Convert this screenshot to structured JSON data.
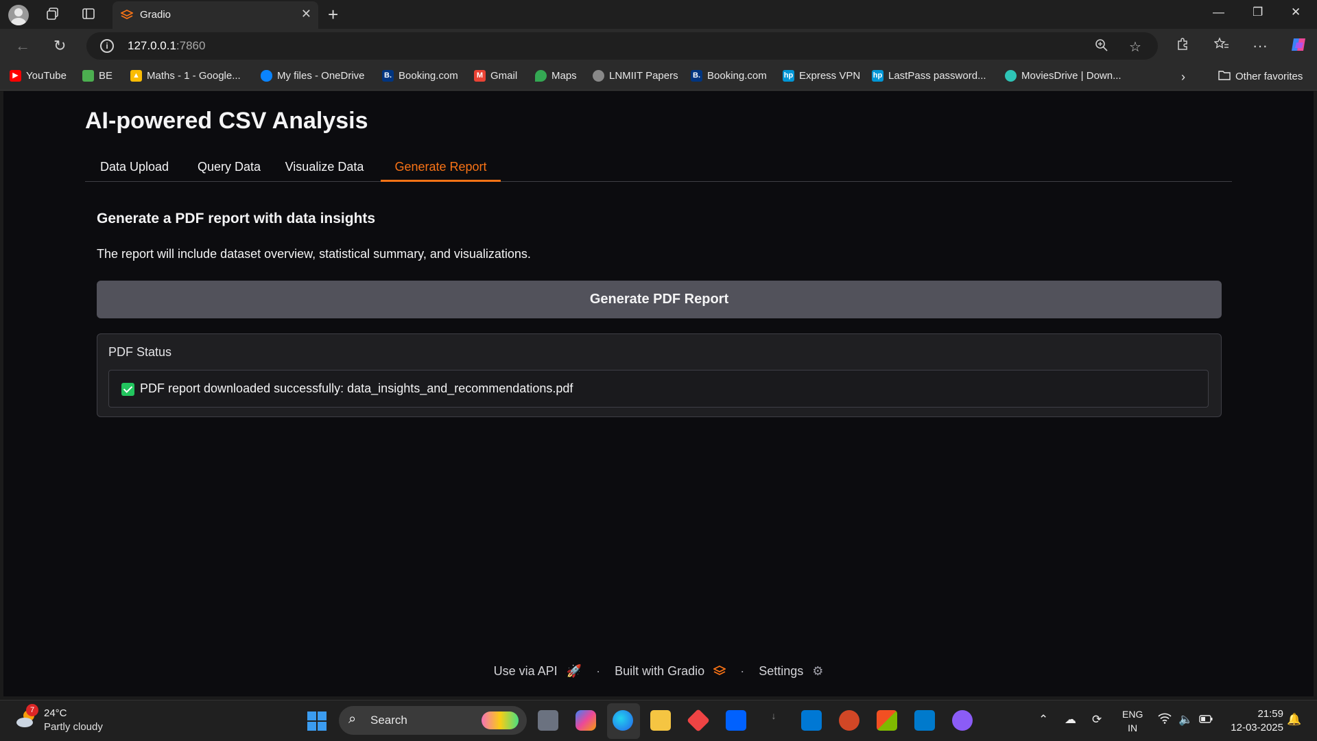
{
  "browser": {
    "tab_title": "Gradio",
    "url_host": "127.0.0.1",
    "url_port": ":7860",
    "bookmarks": [
      {
        "label": "YouTube",
        "icon": "youtube-icon",
        "color": "#ff0000"
      },
      {
        "label": "BE",
        "icon": "be-icon",
        "color": "#4caf50"
      },
      {
        "label": "Maths - 1 - Google...",
        "icon": "google-drive-icon",
        "color": "#fbbc04"
      },
      {
        "label": "My files - OneDrive",
        "icon": "onedrive-icon",
        "color": "#0a84ff"
      },
      {
        "label": "Booking.com",
        "icon": "booking-icon",
        "color": "#003580"
      },
      {
        "label": "Gmail",
        "icon": "gmail-icon",
        "color": "#ea4335"
      },
      {
        "label": "Maps",
        "icon": "maps-icon",
        "color": "#34a853"
      },
      {
        "label": "LNMIIT Papers",
        "icon": "lnmiit-icon",
        "color": "#888888"
      },
      {
        "label": "Booking.com",
        "icon": "booking-icon",
        "color": "#003580"
      },
      {
        "label": "Express VPN",
        "icon": "hp-icon",
        "color": "#0096d6"
      },
      {
        "label": "LastPass password...",
        "icon": "hp-icon",
        "color": "#0096d6"
      },
      {
        "label": "MoviesDrive | Down...",
        "icon": "moviesdrive-icon",
        "color": "#2ec4b6"
      }
    ],
    "other_favorites": "Other favorites"
  },
  "app": {
    "title": "AI-powered CSV Analysis",
    "tabs": [
      {
        "label": "Data Upload",
        "active": false
      },
      {
        "label": "Query Data",
        "active": false
      },
      {
        "label": "Visualize Data",
        "active": false
      },
      {
        "label": "Generate Report",
        "active": true
      }
    ],
    "section_title": "Generate a PDF report with data insights",
    "description": "The report will include dataset overview, statistical summary, and visualizations.",
    "generate_button": "Generate PDF Report",
    "status_label": "PDF Status",
    "status_message": "PDF report downloaded successfully: data_insights_and_recommendations.pdf",
    "accent_color": "#f97316"
  },
  "footer": {
    "api": "Use via API",
    "built": "Built with Gradio",
    "settings": "Settings"
  },
  "taskbar": {
    "weather_temp": "24°C",
    "weather_desc": "Partly cloudy",
    "weather_badge": "7",
    "search": "Search",
    "lang_line1": "ENG",
    "lang_line2": "IN",
    "time": "21:59",
    "date": "12-03-2025"
  }
}
